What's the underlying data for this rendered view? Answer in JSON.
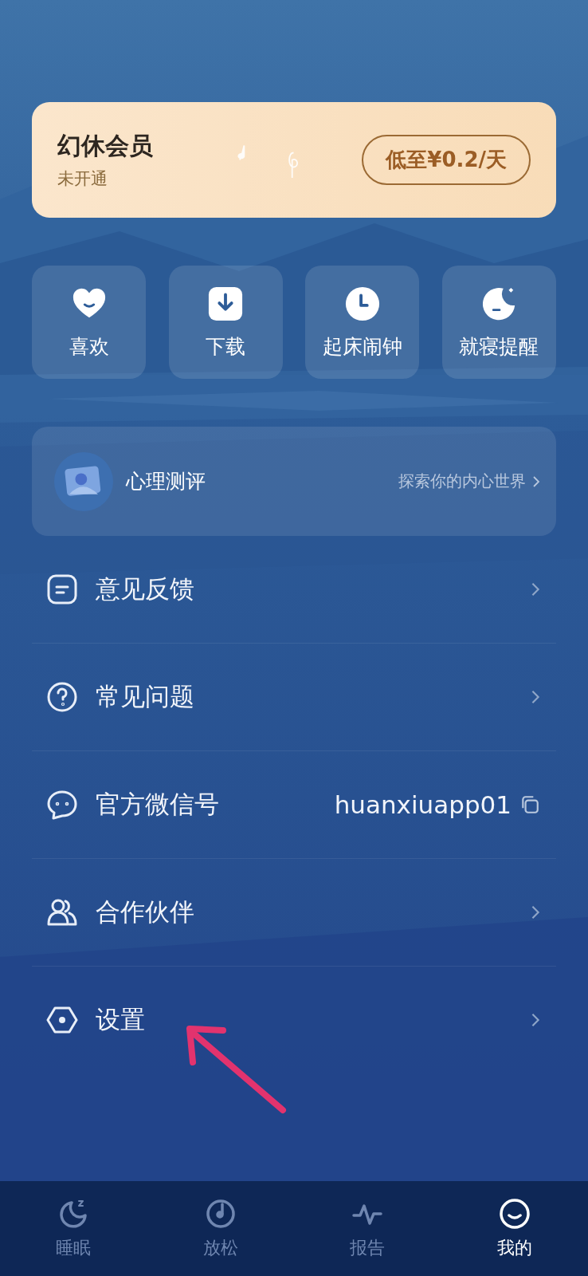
{
  "membership": {
    "title": "幻休会员",
    "status": "未开通",
    "price_button": "低至¥0.2/天"
  },
  "shortcuts": [
    {
      "kind": "heart",
      "label": "喜欢"
    },
    {
      "kind": "download",
      "label": "下载"
    },
    {
      "kind": "clock",
      "label": "起床闹钟"
    },
    {
      "kind": "moon",
      "label": "就寝提醒"
    }
  ],
  "assessment": {
    "title": "心理测评",
    "hint": "探索你的内心世界"
  },
  "menu": [
    {
      "kind": "feedback",
      "label": "意见反馈"
    },
    {
      "kind": "question",
      "label": "常见问题"
    },
    {
      "kind": "wechat",
      "label": "官方微信号",
      "value": "huanxiuapp01"
    },
    {
      "kind": "partner",
      "label": "合作伙伴"
    },
    {
      "kind": "settings",
      "label": "设置"
    }
  ],
  "tabs": [
    {
      "kind": "sleep",
      "label": "睡眠",
      "selected": false
    },
    {
      "kind": "relax",
      "label": "放松",
      "selected": false
    },
    {
      "kind": "report",
      "label": "报告",
      "selected": false
    },
    {
      "kind": "me",
      "label": "我的",
      "selected": true
    }
  ]
}
